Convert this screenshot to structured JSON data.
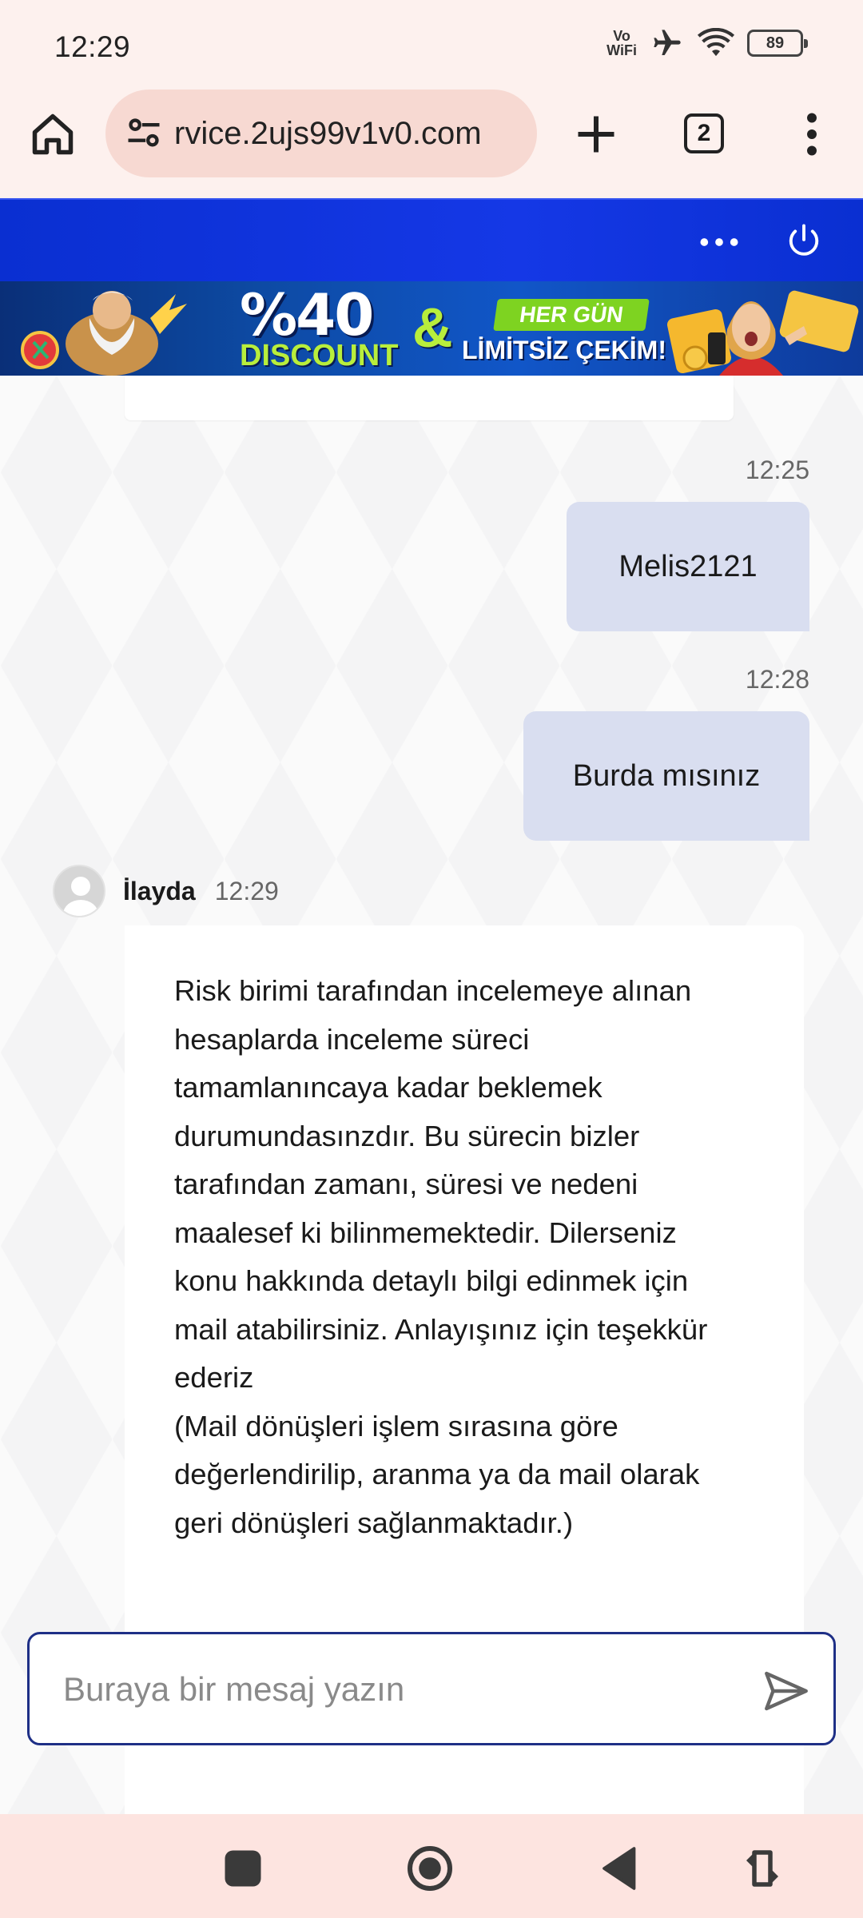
{
  "status_bar": {
    "time": "12:29",
    "vowifi_top": "Vo",
    "vowifi_bottom": "WiFi",
    "battery": "89"
  },
  "browser": {
    "url": "rvice.2ujs99v1v0.com",
    "tab_count": "2",
    "icons": [
      "home-icon",
      "site-settings-icon",
      "plus-icon",
      "tab-switcher-icon",
      "more-vert-icon"
    ]
  },
  "site_header": {
    "color": "#1538e6",
    "icons": [
      "more-horiz-icon",
      "power-icon"
    ]
  },
  "banner": {
    "headline": "%40",
    "subline": "DISCOUNT",
    "ampersand": "&",
    "tag": "HER GÜN",
    "tagline": "LİMİTSİZ ÇEKİM!"
  },
  "chat": {
    "messages": [
      {
        "from": "user",
        "time": "12:25",
        "text": "Melis2121"
      },
      {
        "from": "user",
        "time": "12:28",
        "text": "Burda mısınız"
      }
    ],
    "agent": {
      "name": "İlayda",
      "time": "12:29",
      "text": "Risk birimi tarafından incelemeye alınan\nhesaplarda inceleme süreci\ntamamlanıncaya kadar beklemek\ndurumundasınzdır. Bu sürecin bizler\ntarafından zamanı, süresi ve nedeni\nmaalesef ki bilinmemektedir. Dilerseniz\nkonu hakkında detaylı bilgi edinmek için\nmail atabilirsiniz. Anlayışınız için teşekkür\nederiz\n(Mail dönüşleri işlem sırasına göre\ndeğerlendirilip, aranma ya da mail olarak\ngeri dönüşleri sağlanmaktadır.)"
    }
  },
  "composer": {
    "placeholder": "Buraya bir mesaj yazın",
    "value": "",
    "accent": "#1e2f86"
  },
  "nav_bar": {
    "icons": [
      "recents-square-icon",
      "home-circle-icon",
      "back-triangle-icon",
      "rotate-icon"
    ]
  }
}
